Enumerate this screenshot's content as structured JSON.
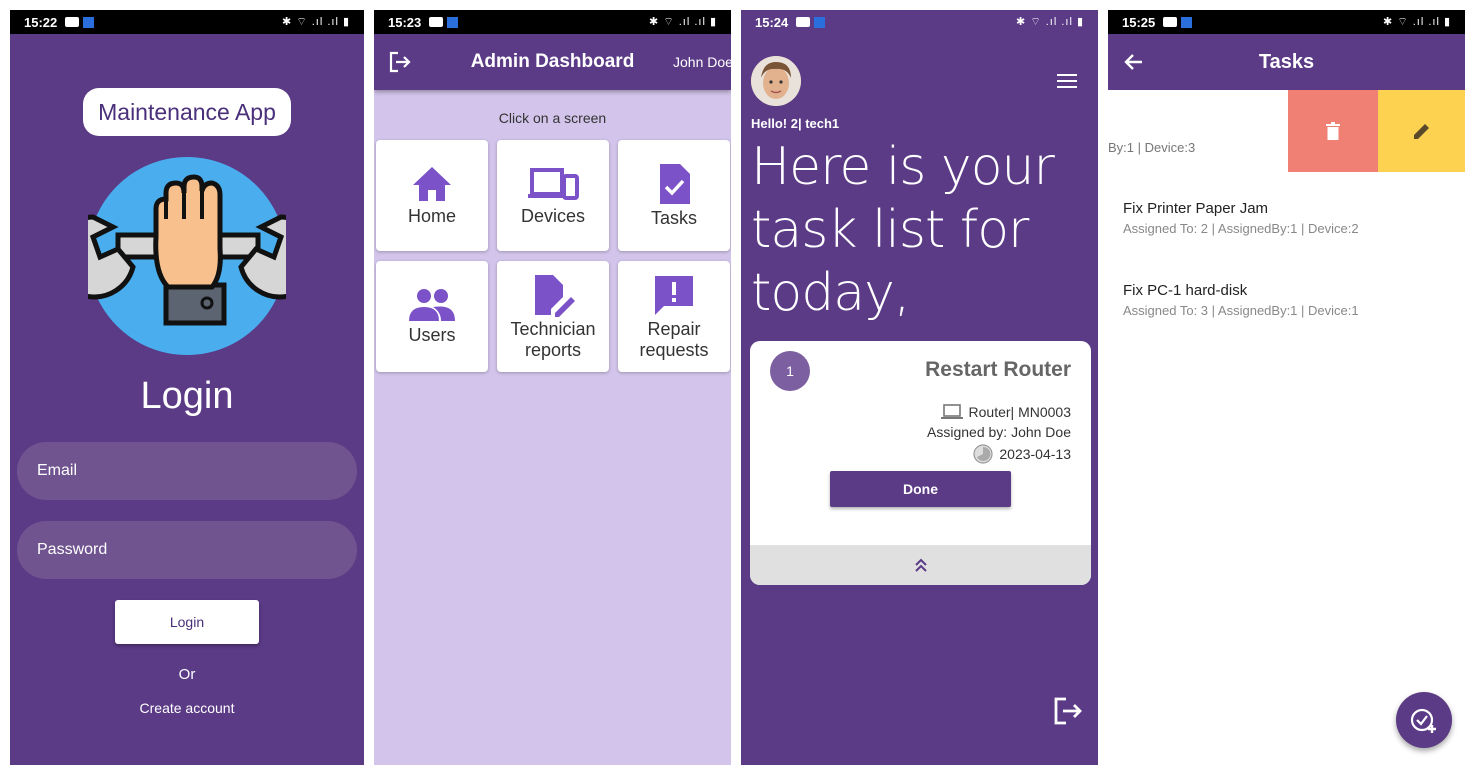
{
  "screens": [
    {
      "status": {
        "time": "15:22"
      },
      "brand": "Maintenance App",
      "title": "Login",
      "email_placeholder": "Email",
      "password_placeholder": "Password",
      "login_button": "Login",
      "or_text": "Or",
      "create_account": "Create account"
    },
    {
      "status": {
        "time": "15:23"
      },
      "title": "Admin Dashboard",
      "user": "John Doe",
      "hint": "Click on a screen",
      "tiles": [
        {
          "label": "Home",
          "icon": "home-icon"
        },
        {
          "label": "Devices",
          "icon": "devices-icon"
        },
        {
          "label": "Tasks",
          "icon": "task-file-icon"
        },
        {
          "label": "Users",
          "icon": "users-icon"
        },
        {
          "label": "Technician reports",
          "icon": "edit-document-icon"
        },
        {
          "label": "Repair requests",
          "icon": "feedback-icon"
        }
      ]
    },
    {
      "status": {
        "time": "15:24"
      },
      "greeting": "Hello! 2| tech1",
      "headline": "Here is your task list for today,",
      "card": {
        "number": "1",
        "title": "Restart Router",
        "device": "Router| MN0003",
        "assigned_by": "Assigned by: John Doe",
        "date": "2023-04-13",
        "done_button": "Done"
      }
    },
    {
      "status": {
        "time": "15:25"
      },
      "title": "Tasks",
      "swiped_text": "By:1 | Device:3",
      "tasks": [
        {
          "title": "Fix Printer Paper Jam",
          "subtitle": "Assigned To: 2 | AssignedBy:1 | Device:2"
        },
        {
          "title": "Fix PC-1 hard-disk",
          "subtitle": "Assigned To: 3 | AssignedBy:1 | Device:1"
        }
      ]
    }
  ],
  "colors": {
    "primary": "#5b3a86",
    "field": "#70548f",
    "dashboard_bg": "#d2c4ea",
    "delete": "#f07f74",
    "edit": "#fdd250",
    "icon_purple": "#7b52c7",
    "logo_circle": "#4aaeee"
  }
}
